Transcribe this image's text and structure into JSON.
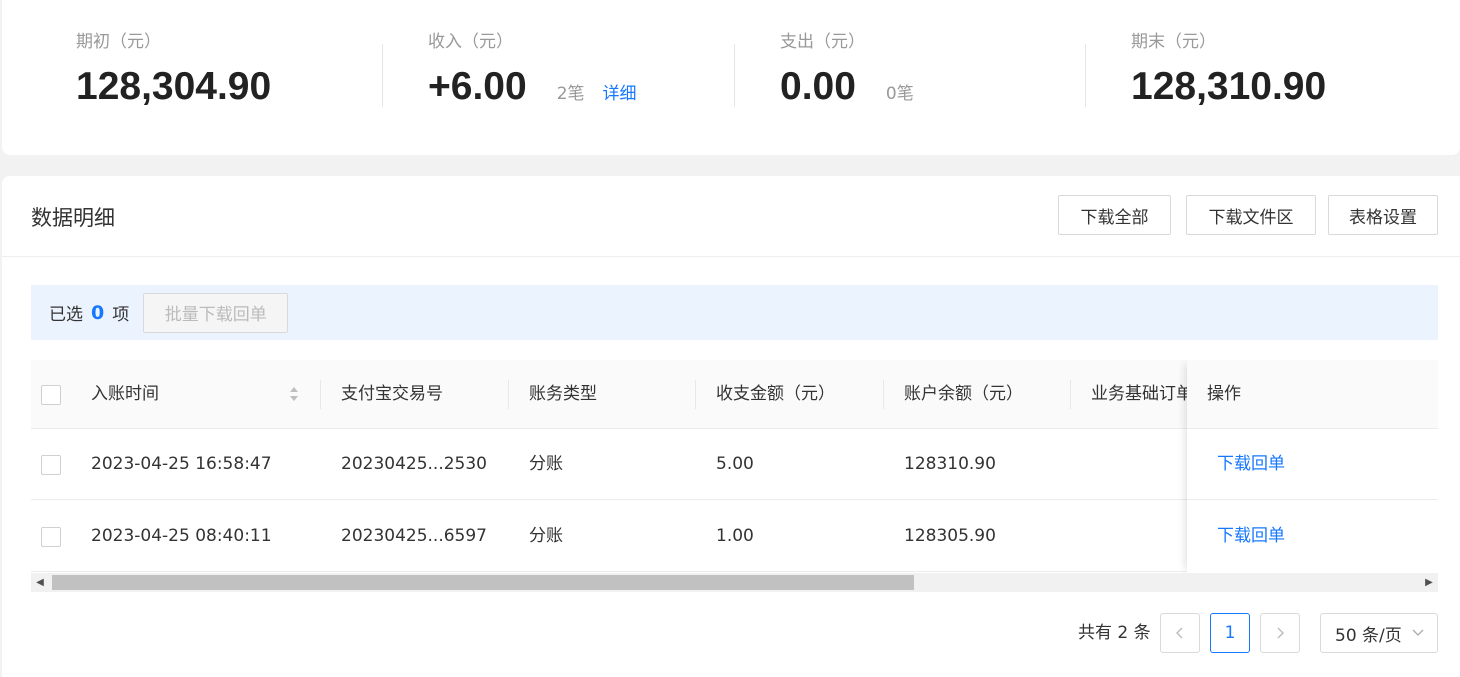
{
  "summary": {
    "opening": {
      "label": "期初（元）",
      "value": "128,304.90"
    },
    "income": {
      "label": "收入（元）",
      "value": "+6.00",
      "count": "2笔",
      "detail_link": "详细"
    },
    "expense": {
      "label": "支出（元）",
      "value": "0.00",
      "count": "0笔"
    },
    "closing": {
      "label": "期末（元）",
      "value": "128,310.90"
    }
  },
  "detail": {
    "title": "数据明细",
    "buttons": {
      "download_all": "下载全部",
      "download_center": "下载文件区",
      "table_settings": "表格设置"
    },
    "selection": {
      "prefix": "已选",
      "count": "0",
      "suffix": "项",
      "batch_button": "批量下载回单"
    }
  },
  "table": {
    "columns": [
      "入账时间",
      "支付宝交易号",
      "账务类型",
      "收支金额（元）",
      "账户余额（元）",
      "业务基础订单号",
      "操作"
    ],
    "rows": [
      {
        "time": "2023-04-25 16:58:47",
        "trade_no": "20230425...2530",
        "type": "分账",
        "amount": "5.00",
        "balance": "128310.90",
        "order": "",
        "action": "下载回单"
      },
      {
        "time": "2023-04-25 08:40:11",
        "trade_no": "20230425...6597",
        "type": "分账",
        "amount": "1.00",
        "balance": "128305.90",
        "order": "",
        "action": "下载回单"
      }
    ]
  },
  "pagination": {
    "total": "共有 2 条",
    "current_page": "1",
    "page_size": "50 条/页"
  },
  "colors": {
    "accent": "#1677ff",
    "selection_bar": "#ebf3ff"
  },
  "icons": [
    "sort-icon",
    "chevron-left-icon",
    "chevron-right-icon",
    "chevron-down-icon",
    "scroll-left-arrow-icon",
    "scroll-right-arrow-icon"
  ]
}
